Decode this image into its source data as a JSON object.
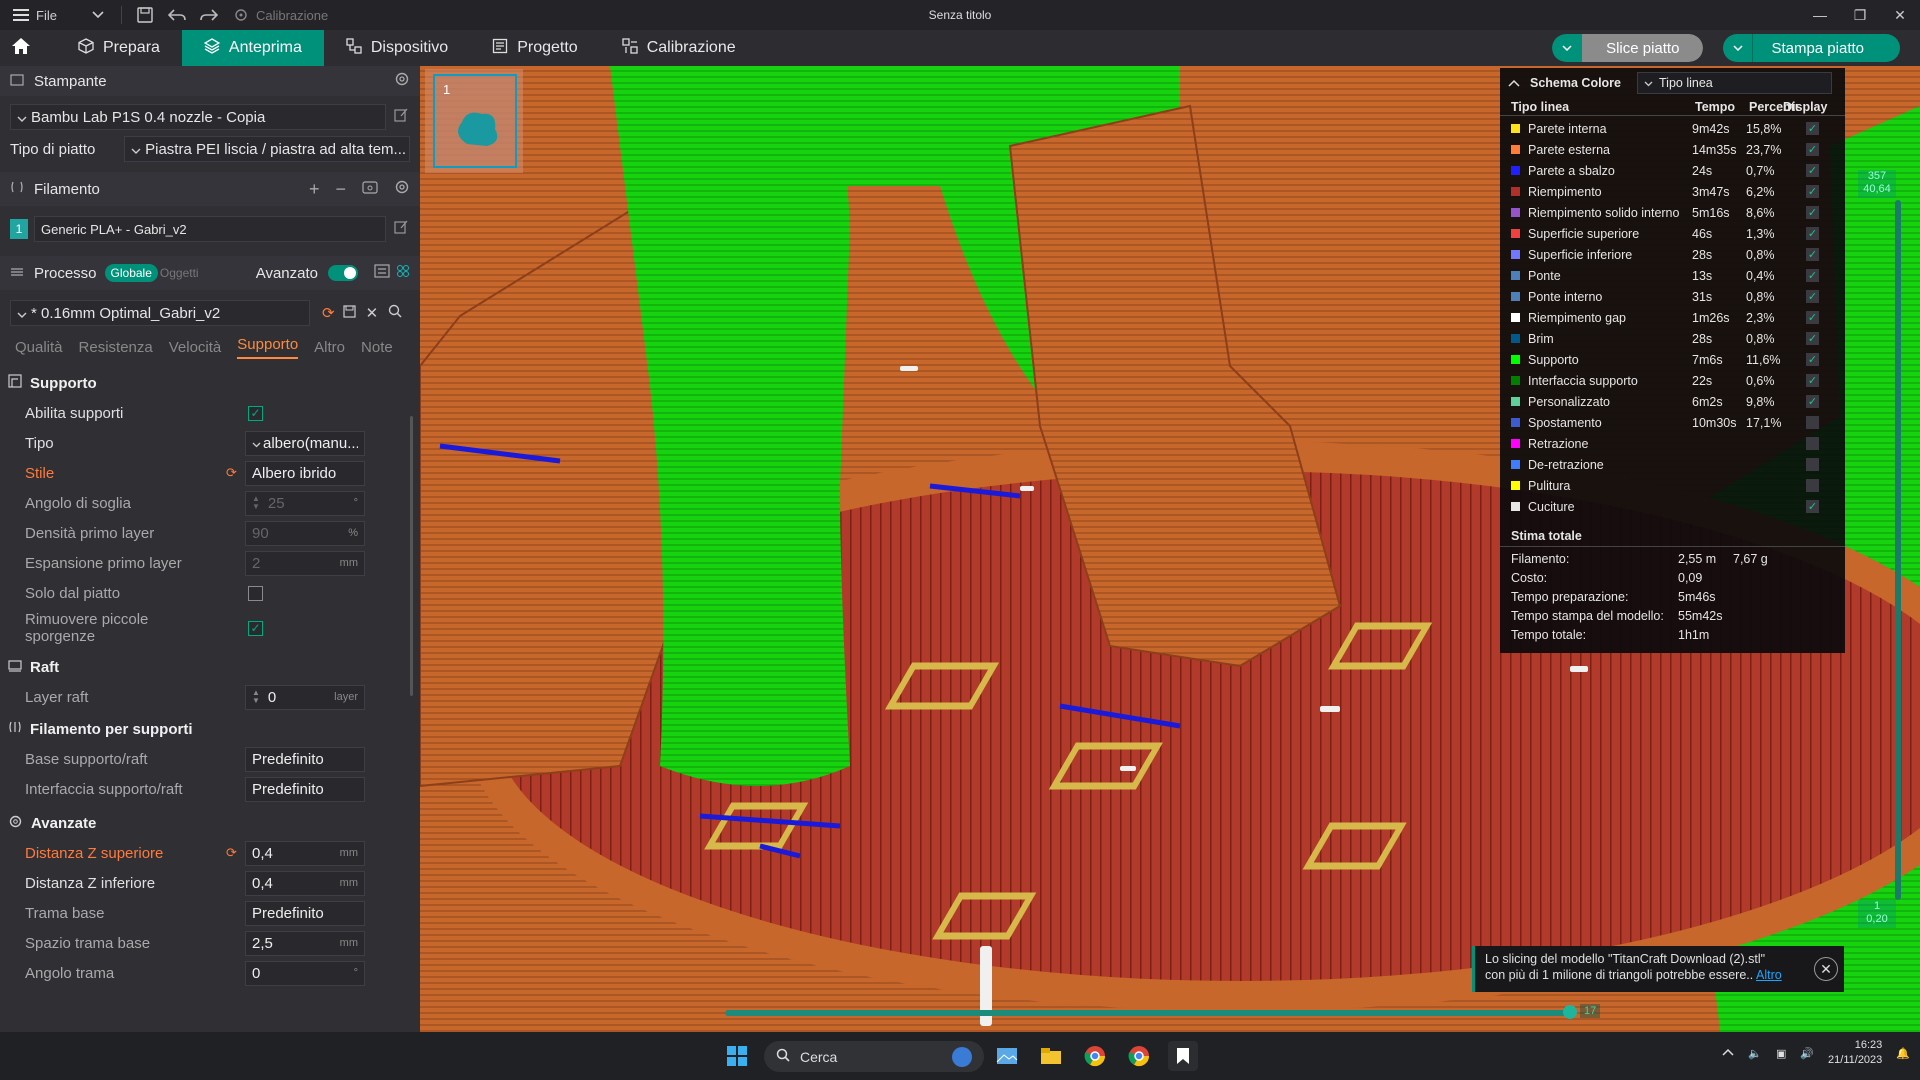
{
  "titlebar": {
    "file_label": "File",
    "calibration_label": "Calibrazione",
    "window_title": "Senza titolo"
  },
  "nav": {
    "tabs": [
      {
        "label": "Prepara"
      },
      {
        "label": "Anteprima"
      },
      {
        "label": "Dispositivo"
      },
      {
        "label": "Progetto"
      },
      {
        "label": "Calibrazione"
      }
    ],
    "slice_label": "Slice piatto",
    "print_label": "Stampa piatto"
  },
  "sidebar": {
    "printer_header": "Stampante",
    "printer_name": "Bambu Lab P1S 0.4 nozzle - Copia",
    "plate_type_label": "Tipo di piatto",
    "plate_type_value": "Piastra PEI liscia / piastra ad alta tem...",
    "filament_header": "Filamento",
    "filament_index": "1",
    "filament_name": "Generic PLA+ -  Gabri_v2",
    "process_header": "Processo",
    "process_global": "Globale",
    "process_objects": "Oggetti",
    "advanced_label": "Avanzato",
    "profile_name": "* 0.16mm Optimal_Gabri_v2",
    "tabs": [
      "Qualità",
      "Resistenza",
      "Velocità",
      "Supporto",
      "Altro",
      "Note"
    ],
    "groups": {
      "support": "Supporto",
      "raft": "Raft",
      "support_filament": "Filamento per supporti",
      "advanced": "Avanzate"
    },
    "props": {
      "enable_support": "Abilita supporti",
      "type_label": "Tipo",
      "type_value": "albero(manu...",
      "style_label": "Stile",
      "style_value": "Albero ibrido",
      "threshold_label": "Angolo di soglia",
      "threshold_value": "25",
      "threshold_unit": "°",
      "first_density_label": "Densità primo layer",
      "first_density_value": "90",
      "first_density_unit": "%",
      "first_expansion_label": "Espansione primo layer",
      "first_expansion_value": "2",
      "first_expansion_unit": "mm",
      "only_plate_label": "Solo dal piatto",
      "remove_small_label": "Rimuovere piccole sporgenze",
      "raft_layers_label": "Layer raft",
      "raft_layers_value": "0",
      "raft_layers_unit": "layer",
      "base_label": "Base supporto/raft",
      "base_value": "Predefinito",
      "interface_label": "Interfaccia supporto/raft",
      "interface_value": "Predefinito",
      "top_z_label": "Distanza Z superiore",
      "top_z_value": "0,4",
      "top_z_unit": "mm",
      "bottom_z_label": "Distanza Z inferiore",
      "bottom_z_value": "0,4",
      "bottom_z_unit": "mm",
      "base_pattern_label": "Trama base",
      "base_pattern_value": "Predefinito",
      "base_spacing_label": "Spazio trama base",
      "base_spacing_value": "2,5",
      "base_spacing_unit": "mm",
      "pattern_angle_label": "Angolo trama",
      "pattern_angle_value": "0",
      "pattern_angle_unit": "°"
    }
  },
  "viewport": {
    "plate_number": "1",
    "layer_top_line1": "357",
    "layer_top_line2": "40,64",
    "layer_bottom_line1": "1",
    "layer_bottom_line2": "0,20",
    "move_value": "17"
  },
  "legend": {
    "title": "Schema Colore",
    "mode": "Tipo linea",
    "col_type": "Tipo linea",
    "col_time": "Tempo",
    "col_pct": "Percentuale",
    "col_display": "Display",
    "rows": [
      {
        "name": "Parete interna",
        "time": "9m42s",
        "pct": "15,8%",
        "color": "#ffe31a",
        "on": true
      },
      {
        "name": "Parete esterna",
        "time": "14m35s",
        "pct": "23,7%",
        "color": "#ff7d38",
        "on": true
      },
      {
        "name": "Parete a sbalzo",
        "time": "24s",
        "pct": "0,7%",
        "color": "#1f1fff",
        "on": true
      },
      {
        "name": "Riempimento",
        "time": "3m47s",
        "pct": "6,2%",
        "color": "#b03029",
        "on": true
      },
      {
        "name": "Riempimento solido interno",
        "time": "5m16s",
        "pct": "8,6%",
        "color": "#9654cc",
        "on": true
      },
      {
        "name": "Superficie superiore",
        "time": "46s",
        "pct": "1,3%",
        "color": "#f04040",
        "on": true
      },
      {
        "name": "Superficie inferiore",
        "time": "28s",
        "pct": "0,8%",
        "color": "#7277ff",
        "on": true
      },
      {
        "name": "Ponte",
        "time": "13s",
        "pct": "0,4%",
        "color": "#4d80ba",
        "on": true
      },
      {
        "name": "Ponte interno",
        "time": "31s",
        "pct": "0,8%",
        "color": "#4d80ba",
        "on": true
      },
      {
        "name": "Riempimento gap",
        "time": "1m26s",
        "pct": "2,3%",
        "color": "#ffffff",
        "on": true
      },
      {
        "name": "Brim",
        "time": "28s",
        "pct": "0,8%",
        "color": "#00598a",
        "on": true
      },
      {
        "name": "Supporto",
        "time": "7m6s",
        "pct": "11,6%",
        "color": "#00ff00",
        "on": true
      },
      {
        "name": "Interfaccia supporto",
        "time": "22s",
        "pct": "0,6%",
        "color": "#008000",
        "on": true
      },
      {
        "name": "Personalizzato",
        "time": "6m2s",
        "pct": "9,8%",
        "color": "#5ed19a",
        "on": true
      },
      {
        "name": "Spostamento",
        "time": "10m30s",
        "pct": "17,1%",
        "color": "#3b5ad3",
        "on": false
      },
      {
        "name": "Retrazione",
        "time": "",
        "pct": "",
        "color": "#ff00ff",
        "on": false
      },
      {
        "name": "De-retrazione",
        "time": "",
        "pct": "",
        "color": "#3e7dff",
        "on": false
      },
      {
        "name": "Pulitura",
        "time": "",
        "pct": "",
        "color": "#ffff00",
        "on": false
      },
      {
        "name": "Cuciture",
        "time": "",
        "pct": "",
        "color": "#e6e6e6",
        "on": true
      }
    ],
    "total_header": "Stima totale",
    "totals": [
      {
        "k": "Filamento:",
        "v": "2,55 m",
        "v2": "7,67 g"
      },
      {
        "k": "Costo:",
        "v": "0,09",
        "v2": ""
      },
      {
        "k": "Tempo preparazione:",
        "v": "5m46s",
        "v2": ""
      },
      {
        "k": "Tempo stampa del modello:",
        "v": "55m42s",
        "v2": ""
      },
      {
        "k": "Tempo totale:",
        "v": "1h1m",
        "v2": ""
      }
    ]
  },
  "toast": {
    "line1": "Lo slicing del modello \"TitanCraft Download (2).stl\"",
    "line2": "con più di 1 milione di triangoli potrebbe essere..",
    "link": "Altro"
  },
  "taskbar": {
    "search_placeholder": "Cerca",
    "time": "16:23",
    "date": "21/11/2023"
  }
}
